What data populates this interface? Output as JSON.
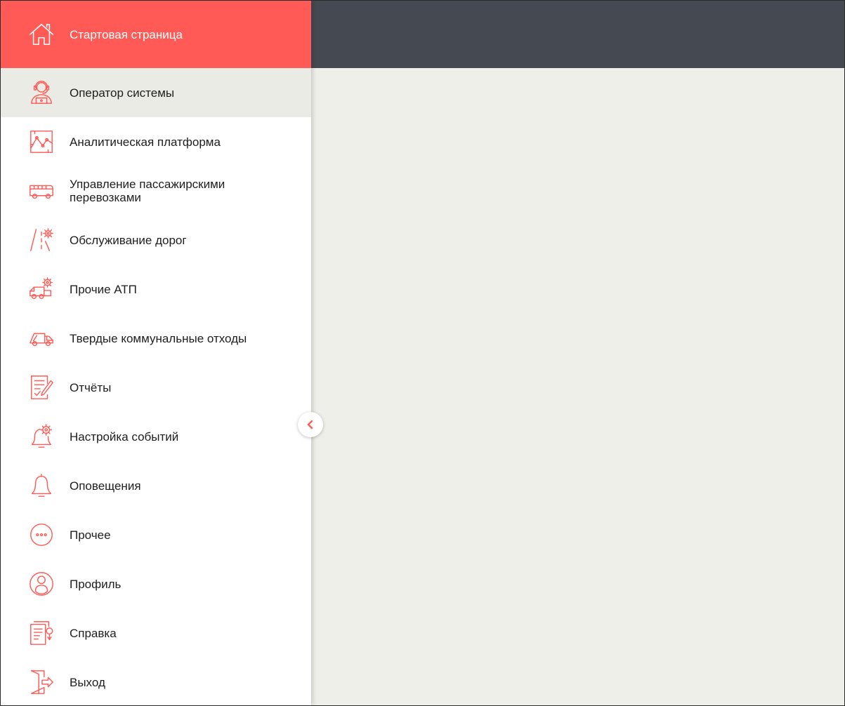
{
  "colors": {
    "accent": "#ff5a55",
    "topbar": "#454a52",
    "content_bg": "#efefea",
    "active_bg": "#ebebe6"
  },
  "sidebar": {
    "home": {
      "label": "Стартовая страница",
      "icon": "home-icon"
    },
    "items": [
      {
        "label": "Оператор системы",
        "icon": "operator-icon",
        "active": true
      },
      {
        "label": "Аналитическая платформа",
        "icon": "analytics-chart-icon"
      },
      {
        "label": "Управление пассажирскими перевозками",
        "icon": "bus-icon"
      },
      {
        "label": "Обслуживание дорог",
        "icon": "road-gear-icon"
      },
      {
        "label": "Прочие АТП",
        "icon": "vehicle-gear-icon"
      },
      {
        "label": "Твердые коммунальные отходы",
        "icon": "garbage-truck-icon"
      },
      {
        "label": "Отчёты",
        "icon": "report-icon"
      },
      {
        "label": "Настройка событий",
        "icon": "bell-gear-icon"
      },
      {
        "label": "Оповещения",
        "icon": "bell-icon"
      },
      {
        "label": "Прочее",
        "icon": "more-dots-icon"
      },
      {
        "label": "Профиль",
        "icon": "profile-icon"
      },
      {
        "label": "Справка",
        "icon": "help-document-icon"
      },
      {
        "label": "Выход",
        "icon": "exit-door-icon"
      }
    ],
    "collapse_icon": "chevron-left-icon"
  }
}
